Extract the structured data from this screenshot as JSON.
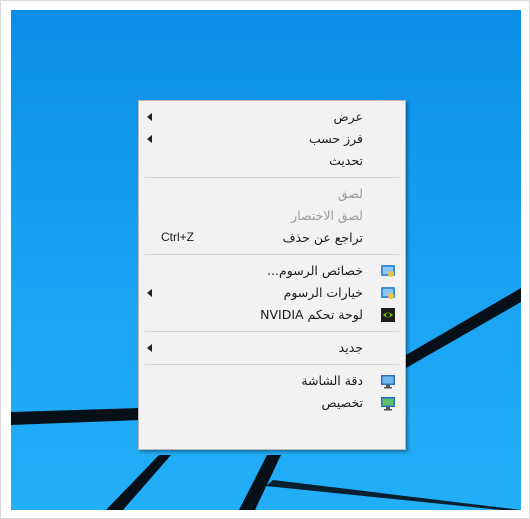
{
  "menu": {
    "view": "عرض",
    "sort_by": "فرز حسب",
    "refresh": "تحديث",
    "paste": "لصق",
    "paste_shortcut": "لصق الاختصار",
    "undo_delete": "تراجع عن حذف",
    "undo_shortcut": "Ctrl+Z",
    "graphics_properties": "خصائص الرسوم...",
    "graphics_options": "خيارات الرسوم",
    "nvidia_control_panel": "لوحة تحكم NVIDIA",
    "new": "جديد",
    "screen_resolution": "دقة الشاشة",
    "personalize": "تخصيص"
  },
  "icons": {
    "graphics_properties": "intel-graphics-icon",
    "graphics_options": "intel-graphics-icon",
    "nvidia_control_panel": "nvidia-icon",
    "screen_resolution": "display-icon",
    "personalize": "personalize-icon"
  },
  "colors": {
    "desktop_blue": "#1aa3f2",
    "menu_background": "#f2f2f2",
    "disabled_text": "#9a9a9a"
  }
}
